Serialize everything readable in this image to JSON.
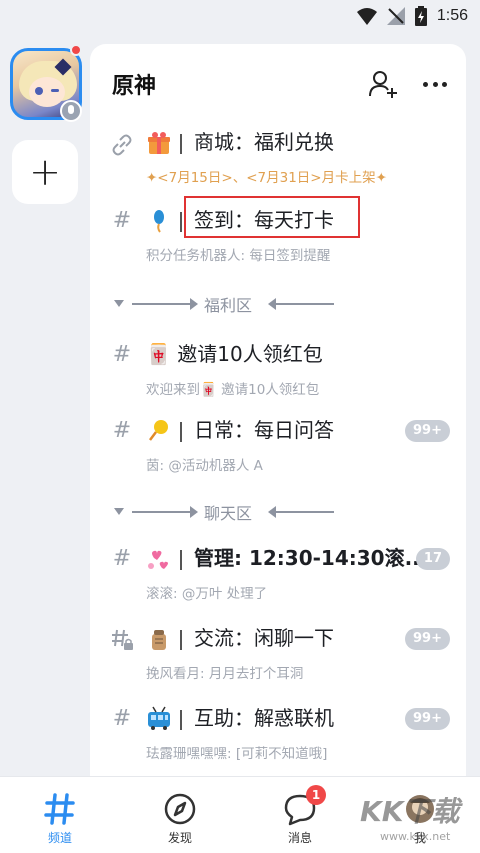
{
  "status": {
    "time": "1:56"
  },
  "guild": {
    "name": "原神"
  },
  "channels": [
    {
      "name": "商城：福利兑换",
      "sub": "✦<7月15日>、<7月31日>月卡上架✦",
      "badge": ""
    },
    {
      "name": "签到：每天打卡",
      "sub": "积分任务机器人: 每日签到提醒",
      "badge": ""
    },
    {
      "name": "🀄 邀请10人领红包",
      "sub": "欢迎来到🀄 邀请10人领红包",
      "badge": ""
    },
    {
      "name": "日常：每日问答",
      "sub": "茵: @活动机器人 A",
      "badge": "99+"
    },
    {
      "name": "管理: 12:30-14:30滚...",
      "sub": "滚滚: @万叶 处理了",
      "badge": "17"
    },
    {
      "name": "交流：闲聊一下",
      "sub": "挽风看月: 月月去打个耳洞",
      "badge": "99+"
    },
    {
      "name": "互助：解惑联机",
      "sub": "珐露珊嘿嘿嘿: [可莉不知道哦]",
      "badge": "99+"
    }
  ],
  "categories": [
    {
      "name": "福利区"
    },
    {
      "name": "聊天区"
    }
  ],
  "nav": {
    "channels": "频道",
    "discover": "发现",
    "messages": "消息",
    "messages_badge": "1",
    "me": "我"
  },
  "watermark": "KK下载",
  "watermark_url": "www.kkx.net",
  "colors": {
    "accent": "#2b8cf0",
    "badge": "#c9ced6",
    "alert": "#f04848",
    "highlight": "#e03232"
  }
}
